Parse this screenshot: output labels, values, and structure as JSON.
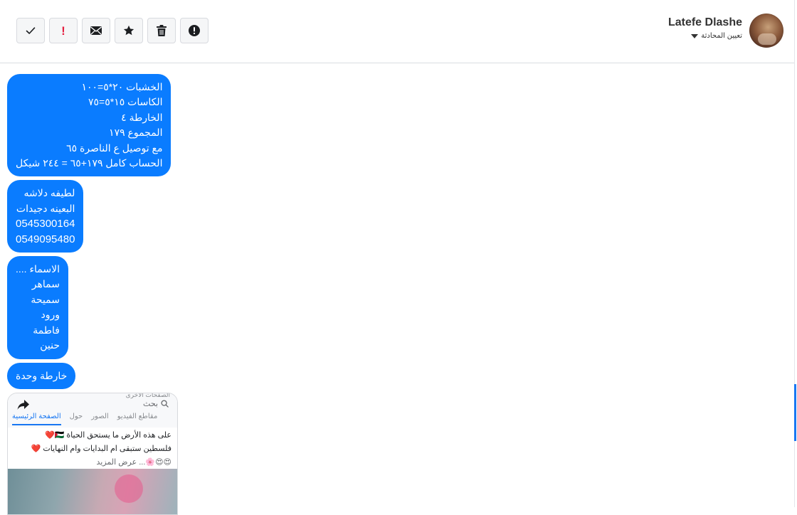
{
  "toolbar": {
    "buttons": [
      {
        "name": "mark-done",
        "icon": "check-icon"
      },
      {
        "name": "mark-important",
        "icon": "exclamation-icon",
        "label": "!"
      },
      {
        "name": "mark-unread",
        "icon": "envelope-icon"
      },
      {
        "name": "star",
        "icon": "star-icon"
      },
      {
        "name": "delete",
        "icon": "trash-icon"
      },
      {
        "name": "report-spam",
        "icon": "alert-circle-icon"
      }
    ]
  },
  "contact": {
    "name": "Latefe Dlashe",
    "assign_label": "تعيين المحادثة",
    "avatar_icon": "profile-photo"
  },
  "messages": [
    {
      "lines": [
        "الخشبات ٢٠*٥=١٠٠",
        "الكاسات ١٥*٥=٧٥",
        "الخارطة ٤",
        "المجموع ١٧٩",
        "مع توصيل ع الناصرة ٦٥",
        "الحساب كامل ١٧٩+٦٥ = ٢٤٤ شيكل"
      ]
    },
    {
      "lines": [
        "لطيفه دلاشه",
        "البعينه دجيدات",
        "0545300164",
        "0549095480"
      ]
    },
    {
      "lines": [
        "الاسماء ....",
        "سماهر",
        "سميحة",
        "ورود",
        "فاطمة",
        "حنين"
      ]
    },
    {
      "lines": [
        "خارطة وحدة"
      ]
    }
  ],
  "attachment": {
    "cut_text": "الصفحات الأخرى",
    "search_placeholder": "بحث",
    "tabs": [
      "الصفحة الرئيسية",
      "حول",
      "الصور",
      "مقاطع الفيديو"
    ],
    "post_lines": [
      "على هذه الأرض ما يستحق الحياة 🇵🇸❤️",
      "فلسطين ستبقى ام البدايات وام النهايات ❤️",
      "😍😍🌸... عرض المزيد"
    ]
  },
  "colors": {
    "bubble": "#0a7cff",
    "accent": "#1877f2",
    "important": "#e41e3f"
  }
}
